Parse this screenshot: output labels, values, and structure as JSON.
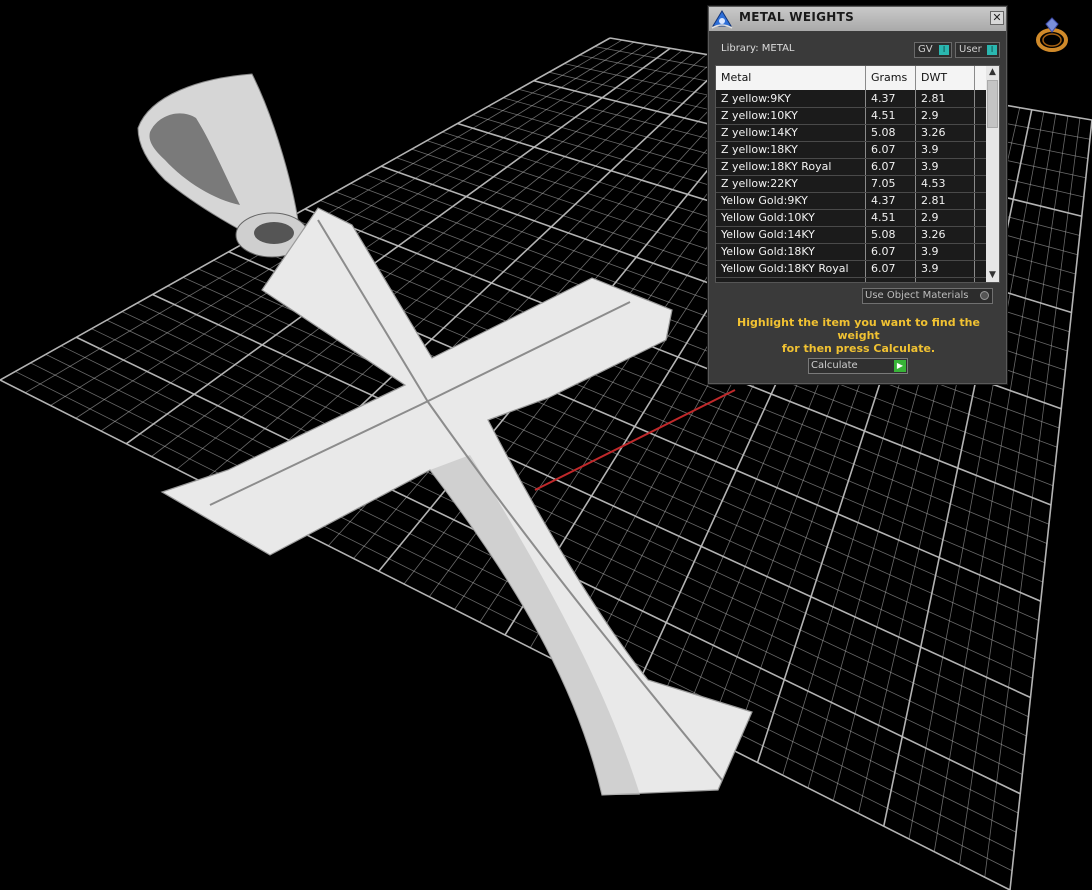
{
  "panel": {
    "title": "METAL WEIGHTS",
    "close_label": "✕",
    "library_label": "Library: METAL",
    "toggles": {
      "gv": "GV",
      "user": "User"
    },
    "columns": [
      "Metal",
      "Grams",
      "DWT"
    ],
    "rows": [
      {
        "metal": "Z yellow:9KY",
        "grams": "4.37",
        "dwt": "2.81"
      },
      {
        "metal": "Z yellow:10KY",
        "grams": "4.51",
        "dwt": "2.9"
      },
      {
        "metal": "Z yellow:14KY",
        "grams": "5.08",
        "dwt": "3.26"
      },
      {
        "metal": "Z yellow:18KY",
        "grams": "6.07",
        "dwt": "3.9"
      },
      {
        "metal": "Z yellow:18KY Royal",
        "grams": "6.07",
        "dwt": "3.9"
      },
      {
        "metal": "Z yellow:22KY",
        "grams": "7.05",
        "dwt": "4.53"
      },
      {
        "metal": "Yellow Gold:9KY",
        "grams": "4.37",
        "dwt": "2.81"
      },
      {
        "metal": "Yellow Gold:10KY",
        "grams": "4.51",
        "dwt": "2.9"
      },
      {
        "metal": "Yellow Gold:14KY",
        "grams": "5.08",
        "dwt": "3.26"
      },
      {
        "metal": "Yellow Gold:18KY",
        "grams": "6.07",
        "dwt": "3.9"
      },
      {
        "metal": "Yellow Gold:18KY Royal",
        "grams": "6.07",
        "dwt": "3.9"
      }
    ],
    "use_object_materials": "Use Object Materials",
    "instruction_line1": "Highlight the item you want to find the weight",
    "instruction_line2": "for then press Calculate.",
    "calculate_label": "Calculate"
  },
  "colors": {
    "background": "#000000",
    "grid": "#bdbdbd",
    "axis_red": "#c0282a",
    "metal": "#e9e9e9",
    "instruction": "#f1c232",
    "toggle_knob": "#2ab7b0",
    "calculate_go": "#38b438"
  },
  "icons": {
    "app_logo": "ring-logo-icon",
    "panel_icon": "rhino-jewel-icon",
    "close": "close-icon",
    "go": "play-arrow-icon"
  }
}
